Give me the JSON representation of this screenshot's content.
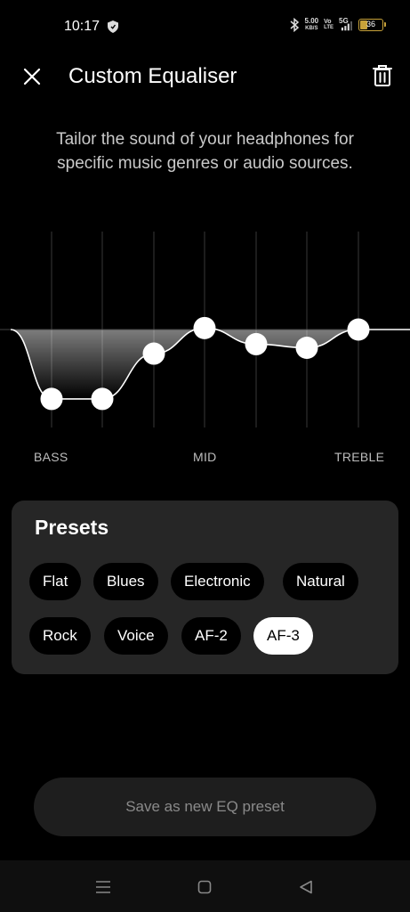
{
  "status_bar": {
    "time": "10:17",
    "net_speed_value": "5.00",
    "net_speed_unit": "KB/S",
    "volte_top": "Vo",
    "volte_bottom": "LTE",
    "network": "5G",
    "battery": "36",
    "battery_level": 0.36
  },
  "header": {
    "title": "Custom Equaliser"
  },
  "description": {
    "line1": "Tailor the sound of your headphones for",
    "line2": "specific music genres or audio sources."
  },
  "equaliser": {
    "bands": [
      {
        "level": -0.95
      },
      {
        "level": -0.95
      },
      {
        "level": -0.33
      },
      {
        "level": 0.02
      },
      {
        "level": -0.2
      },
      {
        "level": -0.25
      },
      {
        "level": 0.0
      }
    ],
    "labels": {
      "bass": "BASS",
      "mid": "MID",
      "treble": "TREBLE"
    }
  },
  "presets": {
    "title": "Presets",
    "items": [
      "Flat",
      "Blues",
      "Electronic",
      "Natural",
      "Rock",
      "Voice",
      "AF-2",
      "AF-3"
    ],
    "selected": "AF-3"
  },
  "save_button": {
    "label": "Save as new EQ preset"
  },
  "colors": {
    "background": "#000000",
    "card": "#262626",
    "accent": "#ffffff",
    "battery": "#c8a23a"
  },
  "icons": {
    "close": "close-icon",
    "delete": "trash-icon",
    "nav_menu": "menu-icon",
    "nav_home": "home-icon",
    "nav_back": "back-icon"
  }
}
